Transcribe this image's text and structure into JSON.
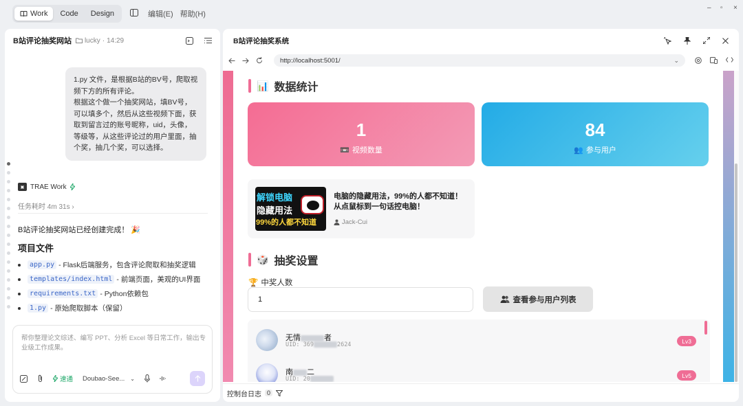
{
  "topbar": {
    "modes": [
      {
        "label": "Work",
        "active": true,
        "icon": "book-icon"
      },
      {
        "label": "Code",
        "active": false
      },
      {
        "label": "Design",
        "active": false
      }
    ],
    "menus": [
      "编辑(E)",
      "帮助(H)"
    ]
  },
  "chat": {
    "title": "B站评论抽奖网站",
    "folder": "lucky",
    "time": "14:29",
    "user_message": "1.py 文件，是根据B站的BV号，爬取视频下方的所有评论。\n根据这个做一个抽奖网站，填BV号，可以填多个，然后从这些视频下面，获取到留言过的账号昵称，uid，头像，等级等，从这些评论过的用户里面，抽个奖，抽几个奖，可以选择。",
    "agent_name": "TRAE Work",
    "duration": "任务耗时 4m 31s",
    "done_message": "B站评论抽奖网站已经创建完成！",
    "done_emoji": "🎉",
    "project_files_title": "项目文件",
    "files": [
      {
        "name": "app.py",
        "desc": "- Flask后端服务，包含评论爬取和抽奖逻辑"
      },
      {
        "name": "templates/index.html",
        "desc": "- 前端页面，美观的UI界面"
      },
      {
        "name": "requirements.txt",
        "desc": "- Python依赖包"
      },
      {
        "name": "1.py",
        "desc": "- 原始爬取脚本（保留）"
      }
    ],
    "input_placeholder": "帮你整理论文综述、编写 PPT、分析 Excel 等日常工作，输出专业级工作成果。",
    "speed_label": "速通",
    "model_label": "Doubao-See..."
  },
  "preview": {
    "title": "B站评论抽奖系统",
    "url": "http://localhost:5001/",
    "stats_section": {
      "icon": "📊",
      "title": "数据统计"
    },
    "stats": [
      {
        "value": "1",
        "label": "视频数量",
        "icon": "📼"
      },
      {
        "value": "84",
        "label": "参与用户",
        "icon": "👥"
      }
    ],
    "video": {
      "thumb_lines": [
        "解锁电脑",
        "隐藏用法",
        "99%的人都不知道"
      ],
      "title": "电脑的隐藏用法，99%的人都不知道！从点鼠标到一句话控电脑！",
      "author": "Jack-Cui"
    },
    "lottery_section": {
      "icon": "🎲",
      "title": "抽奖设置"
    },
    "winner_label": "中奖人数",
    "winner_icon": "🏆",
    "winner_value": "1",
    "view_users_button": "查看参与用户列表",
    "users": [
      {
        "name_start": "无情",
        "name_end": "者",
        "uid_start": "UID: 369",
        "uid_end": "2624",
        "level": "Lv3"
      },
      {
        "name_start": "南",
        "name_end": "二",
        "uid_start": "UID: 20",
        "uid_end": "",
        "level": "Lv5"
      }
    ],
    "console_label": "控制台日志",
    "console_count": "0"
  },
  "colors": {
    "pink": "#ef6d95",
    "blue": "#2fb2e8",
    "accent_send": "#dcd4fb"
  }
}
